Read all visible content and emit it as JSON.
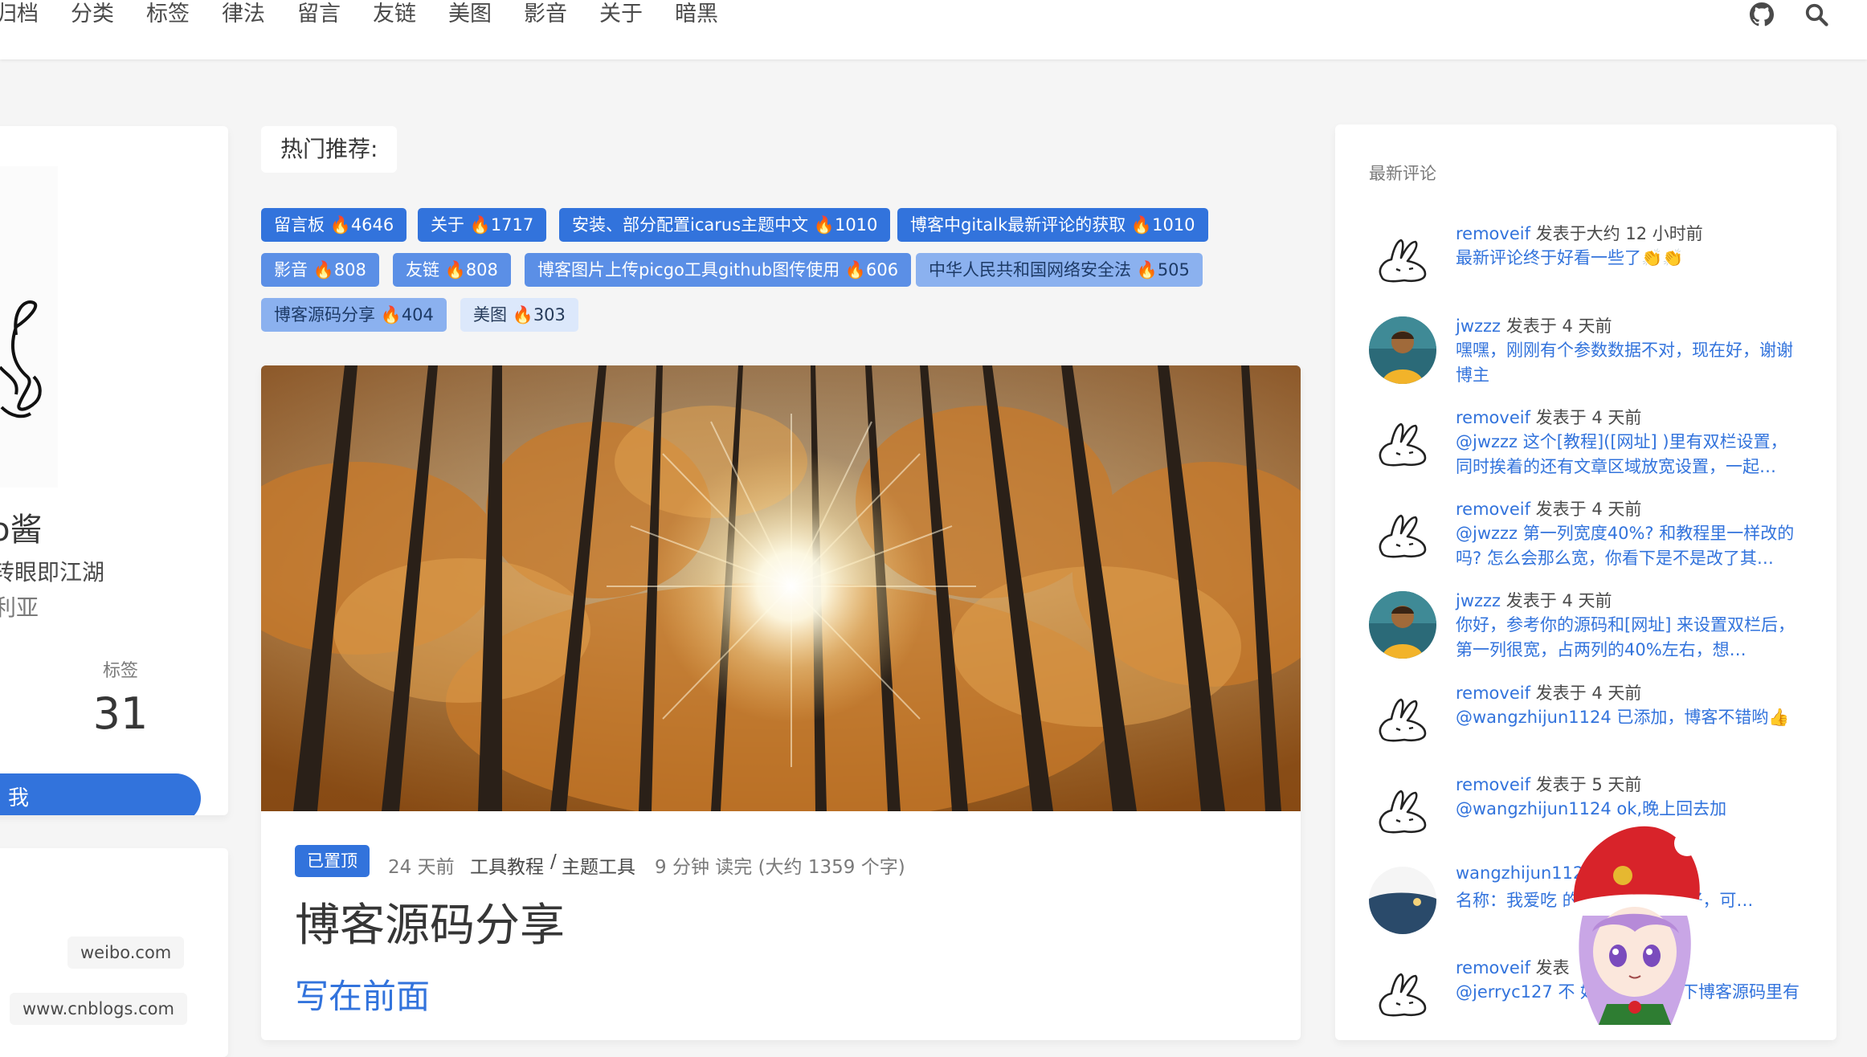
{
  "nav": {
    "items": [
      "归档",
      "分类",
      "标签",
      "律法",
      "留言",
      "友链",
      "美图",
      "影音",
      "关于",
      "暗黑"
    ]
  },
  "profile": {
    "name": "o酱",
    "bio": "转眼即江湖",
    "location": "利亚",
    "stat_label": "标签",
    "stat_value": "31",
    "follow_label": "我"
  },
  "links": [
    "weibo.com",
    "www.cnblogs.com"
  ],
  "hot": {
    "title": "热门推荐:",
    "tags": [
      {
        "label": "留言板 🔥4646"
      },
      {
        "label": "关于 🔥1717"
      },
      {
        "label": "安装、部分配置icarus主题中文 🔥1010"
      },
      {
        "label": "博客中gitalk最新评论的获取 🔥1010"
      },
      {
        "label": "影音 🔥808"
      },
      {
        "label": "友链 🔥808"
      },
      {
        "label": "博客图片上传picgo工具github图传使用 🔥606"
      },
      {
        "label": "中华人民共和国网络安全法 🔥505"
      },
      {
        "label": "博客源码分享 🔥404"
      },
      {
        "label": "美图 🔥303"
      }
    ]
  },
  "post": {
    "pinned": "已置顶",
    "date": "24 天前",
    "category": "工具教程",
    "category_sep": "/",
    "subcategory": "主题工具",
    "read": "9 分钟 读完 (大约 1359 个字)",
    "title": "博客源码分享",
    "subheading": "写在前面"
  },
  "comments": {
    "title": "最新评论",
    "items": [
      {
        "user": "removeif",
        "time": "发表于大约 12 小时前",
        "text": "最新评论终于好看一些了👏👏",
        "avatar": "rabbit-icon"
      },
      {
        "user": "jwzzz",
        "time": "发表于 4 天前",
        "text": "嘿嘿，刚刚有个参数数据不对，现在好，谢谢博主",
        "avatar": "person-avatar"
      },
      {
        "user": "removeif",
        "time": "发表于 4 天前",
        "text": "@jwzzz 这个[教程]([网址] )里有双栏设置，同时挨着的还有文章区域放宽设置，一起…",
        "avatar": "rabbit-icon"
      },
      {
        "user": "removeif",
        "time": "发表于 4 天前",
        "text": "@jwzzz 第一列宽度40%? 和教程里一样改的吗? 怎么会那么宽，你看下是不是改了其…",
        "avatar": "rabbit-icon"
      },
      {
        "user": "jwzzz",
        "time": "发表于 4 天前",
        "text": "你好，参考你的源码和[网址] 来设置双栏后，第一列很宽，占两列的40%左右，想…",
        "avatar": "person-avatar"
      },
      {
        "user": "removeif",
        "time": "发表于 4 天前",
        "text": "@wangzhijun1124 已添加，博客不错哟👍",
        "avatar": "rabbit-icon"
      },
      {
        "user": "removeif",
        "time": "发表于 5 天前",
        "text": "@wangzhijun1124 ok,晚上回去加",
        "avatar": "rabbit-icon"
      },
      {
        "user": "wangzhijun112",
        "time": "",
        "text": "名称：我爱吃          的程序员站点：            好，可…",
        "avatar": "scenery-avatar"
      },
      {
        "user": "removeif",
        "time": "发表",
        "text": "@jerryc127 不         好了，可以看下博客源码里有",
        "avatar": "rabbit-icon"
      }
    ]
  }
}
